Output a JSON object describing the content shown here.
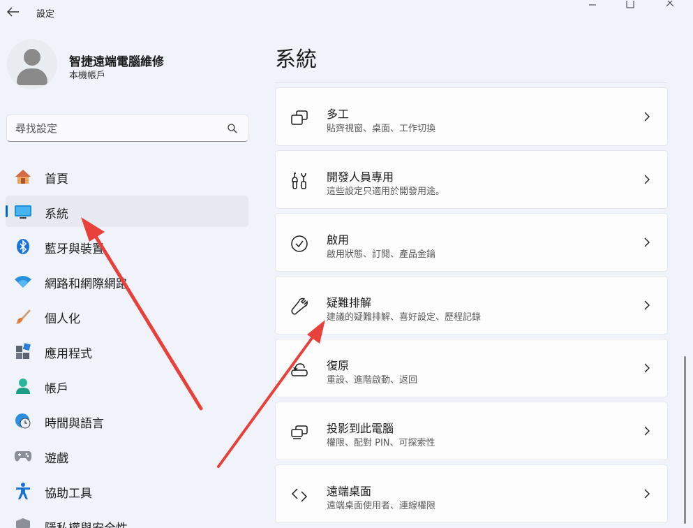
{
  "window": {
    "title": "設定"
  },
  "profile": {
    "name": "智捷遠端電腦維修",
    "account_type": "本機帳戶"
  },
  "search": {
    "placeholder": "尋找設定"
  },
  "nav": {
    "items": [
      {
        "label": "首頁",
        "icon": "home-icon"
      },
      {
        "label": "系統",
        "icon": "system-monitor-icon",
        "active": true
      },
      {
        "label": "藍牙與裝置",
        "icon": "bluetooth-icon"
      },
      {
        "label": "網路和網際網路",
        "icon": "wifi-icon"
      },
      {
        "label": "個人化",
        "icon": "paintbrush-icon"
      },
      {
        "label": "應用程式",
        "icon": "apps-icon"
      },
      {
        "label": "帳戶",
        "icon": "account-icon"
      },
      {
        "label": "時間與語言",
        "icon": "clock-globe-icon"
      },
      {
        "label": "遊戲",
        "icon": "gamepad-icon"
      },
      {
        "label": "協助工具",
        "icon": "accessibility-icon"
      },
      {
        "label": "隱私權與安全性",
        "icon": "shield-icon"
      }
    ]
  },
  "main": {
    "title": "系統",
    "cards": [
      {
        "title": "多工",
        "subtitle": "貼齊視窗、桌面、工作切換",
        "icon": "multitasking-icon"
      },
      {
        "title": "開發人員專用",
        "subtitle": "這些設定只適用於開發用途。",
        "icon": "developer-tools-icon"
      },
      {
        "title": "啟用",
        "subtitle": "啟用狀態、訂閱、產品金鑰",
        "icon": "activation-check-icon"
      },
      {
        "title": "疑難排解",
        "subtitle": "建議的疑難排解、喜好設定、歷程記錄",
        "icon": "wrench-icon"
      },
      {
        "title": "復原",
        "subtitle": "重設、進階啟動、返回",
        "icon": "recovery-icon"
      },
      {
        "title": "投影到此電腦",
        "subtitle": "權限、配對 PIN、可探索性",
        "icon": "project-icon"
      },
      {
        "title": "遠端桌面",
        "subtitle": "遠端桌面使用者、連線權限",
        "icon": "remote-desktop-icon"
      }
    ]
  },
  "colors": {
    "accent": "#0067c0",
    "annotation_arrow": "#e8413b"
  }
}
